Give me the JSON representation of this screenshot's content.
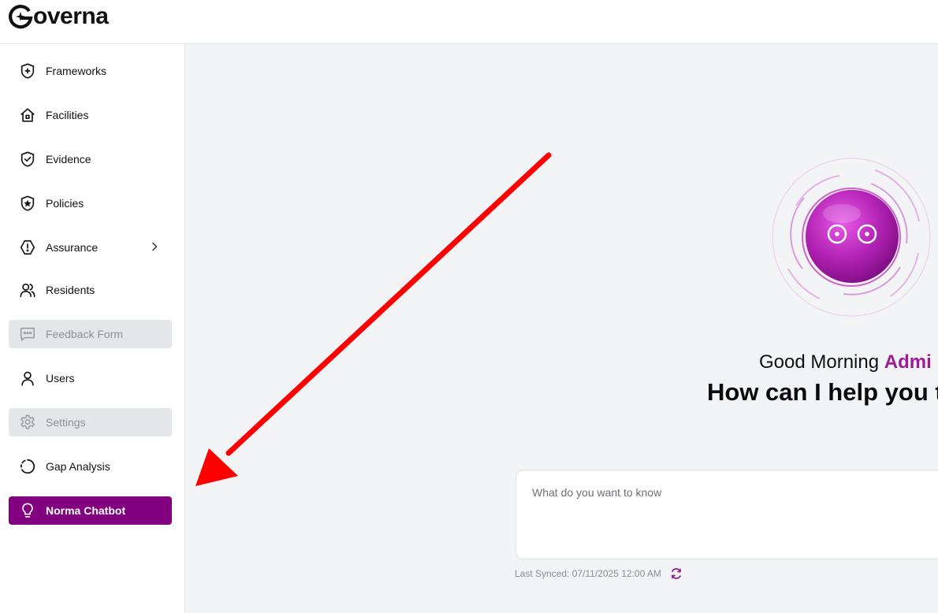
{
  "app": {
    "logo_text": "overna"
  },
  "sidebar": {
    "items": [
      {
        "label": "Frameworks",
        "icon": "shield-plus-icon",
        "state": "normal"
      },
      {
        "label": "Facilities",
        "icon": "home-icon",
        "state": "normal"
      },
      {
        "label": "Evidence",
        "icon": "shield-check-icon",
        "state": "normal"
      },
      {
        "label": "Policies",
        "icon": "shield-star-icon",
        "state": "normal"
      },
      {
        "label": "Assurance",
        "icon": "octagon-alert-icon",
        "state": "normal",
        "has_submenu": true
      },
      {
        "label": "Residents",
        "icon": "users-icon",
        "state": "normal"
      },
      {
        "label": "Feedback Form",
        "icon": "message-dots-icon",
        "state": "disabled"
      },
      {
        "label": "Users",
        "icon": "user-icon",
        "state": "normal"
      },
      {
        "label": "Settings",
        "icon": "gear-icon",
        "state": "disabled"
      },
      {
        "label": "Gap Analysis",
        "icon": "loader-circle-icon",
        "state": "normal"
      },
      {
        "label": "Norma Chatbot",
        "icon": "lightbulb-icon",
        "state": "active"
      }
    ]
  },
  "main": {
    "greeting_prefix": "Good Morning",
    "greeting_name": "Admi",
    "help_text": "How can I help you to",
    "chat": {
      "placeholder": "What do you want to know",
      "value": ""
    },
    "last_synced": "Last Synced: 07/11/2025 12:00 AM"
  },
  "colors": {
    "accent": "#820080",
    "accent_text": "#a01a96",
    "arrow": "#ff0000",
    "bot": "#b21fb8"
  }
}
